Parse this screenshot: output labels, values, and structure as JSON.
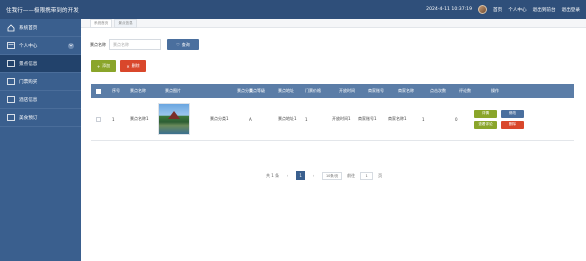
{
  "app": {
    "title": "住我行——极限携带到的开发",
    "datetime": "2024-4-11 10:37:19",
    "nav_links": [
      "首页",
      "个人中心",
      "退出到前台",
      "退出登录"
    ]
  },
  "sidebar": {
    "items": [
      {
        "label": "系统首页",
        "icon": "home-icon"
      },
      {
        "label": "个人中心",
        "icon": "user-card-icon",
        "has_chevron": true
      },
      {
        "label": "景点信息",
        "icon": "list-icon",
        "active": true
      },
      {
        "label": "门票购买",
        "icon": "list-icon"
      },
      {
        "label": "酒店信息",
        "icon": "list-icon"
      },
      {
        "label": "美食预订",
        "icon": "list-icon"
      }
    ]
  },
  "breadcrumb": [
    "系统首页",
    "景点信息"
  ],
  "search": {
    "label": "景点名称",
    "placeholder": "景点名称",
    "button_label": "查询"
  },
  "actions": {
    "add_label": "添加",
    "delete_label": "删除"
  },
  "table": {
    "columns": [
      "序号",
      "景点名称",
      "景点图片",
      "景点分类",
      "景点等级",
      "景点地址",
      "门票价格",
      "开放时间",
      "商家账号",
      "商家名称",
      "点击次数",
      "评论数",
      "操作"
    ],
    "rows": [
      {
        "index": "1",
        "name": "景点名称1",
        "category": "景点分类1",
        "level": "A",
        "address": "景点地址1",
        "price": "1",
        "open_time": "开放时间1",
        "merchant_account": "商家账号1",
        "merchant_name": "商家名称1",
        "clicks": "1",
        "comments": "0",
        "ops": {
          "detail": "详情",
          "edit": "修改",
          "review": "查看评论",
          "delete": "删除"
        }
      }
    ]
  },
  "pager": {
    "total": "共 1 条",
    "prev": "‹",
    "page": "1",
    "next": "›",
    "page_size": "10条/页",
    "goto_label": "前往",
    "goto_value": "1",
    "page_unit": "页"
  },
  "colors": {
    "topbar": "#2f4f7a",
    "sidebar": "#3a5f8e",
    "accent_green": "#8aa52a",
    "accent_red": "#d9472b"
  }
}
